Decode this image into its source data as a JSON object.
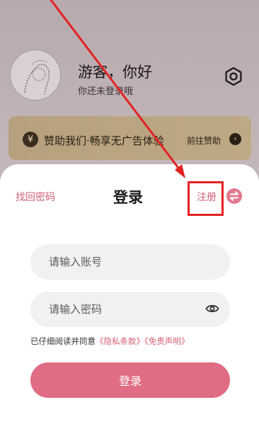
{
  "profile": {
    "greeting": "游客，你好",
    "sub_greeting": "你还未登录哦"
  },
  "sponsor": {
    "icon_symbol": "¥",
    "text": "赞助我们·畅享无广告体验",
    "link": "前往赞助",
    "arrow_symbol": "›"
  },
  "login_sheet": {
    "forgot_password": "找回密码",
    "title": "登录",
    "register": "注册",
    "account_placeholder": "请输入账号",
    "password_placeholder": "请输入密码",
    "agreement_prefix": "已仔细阅读并同意",
    "privacy_terms": "《隐私条款》",
    "disclaimer": "《免责声明》",
    "login_button": "登录"
  },
  "colors": {
    "accent": "#d45f78",
    "login_button": "#e06d83",
    "annotation_red": "#e32222"
  },
  "icons": [
    "user-avatar",
    "gear-icon",
    "yen-icon",
    "chevron-right-icon",
    "swap-icon",
    "eye-icon"
  ]
}
